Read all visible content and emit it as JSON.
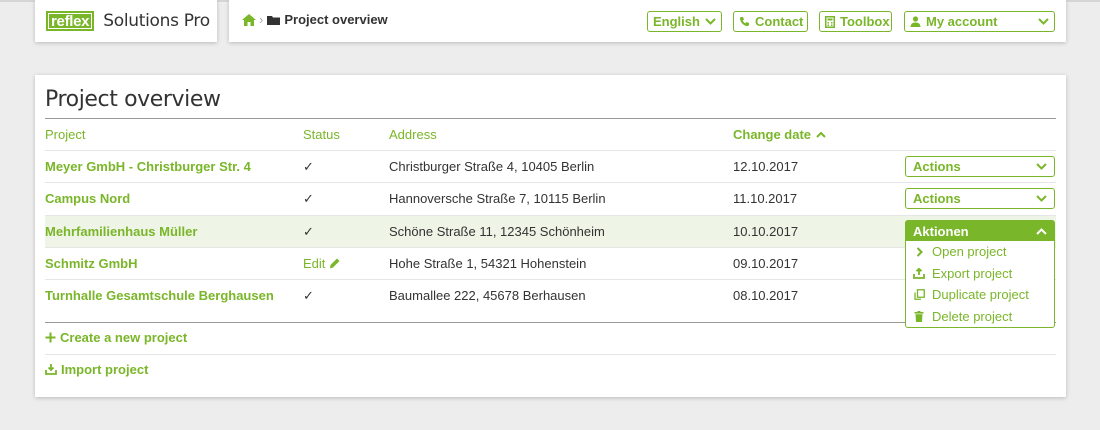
{
  "brand": {
    "logo_text": "reflex",
    "app_name": "Solutions Pro"
  },
  "breadcrumb": {
    "home_icon": "home-icon",
    "folder_icon": "folder-icon",
    "current": "Project overview"
  },
  "topnav": {
    "language": "English",
    "contact": "Contact",
    "toolbox": "Toolbox",
    "account": "My account"
  },
  "page": {
    "title": "Project overview"
  },
  "table": {
    "headers": {
      "project": "Project",
      "status": "Status",
      "address": "Address",
      "change_date": "Change date"
    },
    "rows": [
      {
        "project": "Meyer GmbH - Christburger Str. 4",
        "status": "✓",
        "address": "Christburger Straße 4, 10405 Berlin",
        "date": "12.10.2017",
        "action": "Actions"
      },
      {
        "project": "Campus Nord",
        "status": "✓",
        "address": "Hannoversche Straße 7, 10115 Berlin",
        "date": "11.10.2017",
        "action": "Actions"
      },
      {
        "project": "Mehrfamilienhaus Müller",
        "status": "✓",
        "address": "Schöne Straße 11, 12345 Schönheim",
        "date": "10.10.2017",
        "action": "Aktionen"
      },
      {
        "project": "Schmitz GmbH",
        "status": "Edit",
        "address": "Hohe Straße 1, 54321 Hohenstein",
        "date": "09.10.2017"
      },
      {
        "project": "Turnhalle Gesamtschule Berghausen",
        "status": "✓",
        "address": "Baumallee 222, 45678 Berhausen",
        "date": "08.10.2017"
      }
    ]
  },
  "dropdown": {
    "items": [
      "Open project",
      "Export project",
      "Duplicate project",
      "Delete project"
    ]
  },
  "links": {
    "create": "Create a new project",
    "import": "Import project"
  },
  "colors": {
    "accent": "#7ab629",
    "highlight_row": "#eef4e6",
    "background": "#ededed"
  }
}
